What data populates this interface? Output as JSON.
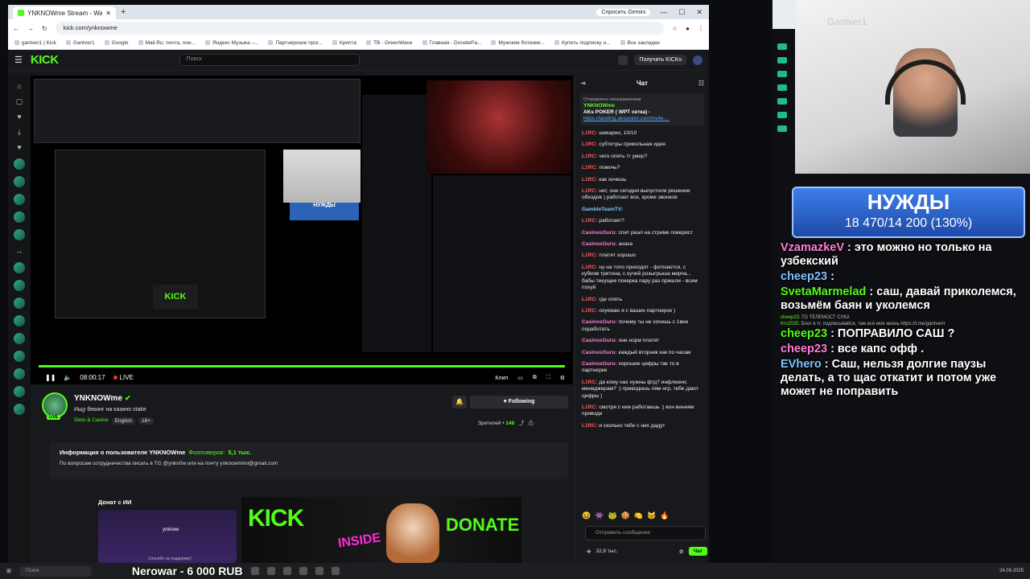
{
  "browser": {
    "tab_title": "YNKNOWme Stream - Watch L",
    "gemini_label": "Спросить Gemini",
    "url": "kick.com/ynknowme",
    "bookmarks": [
      "gantver1 | Kick",
      "Gantver1",
      "Google",
      "Mail.Ru: почта, пои...",
      "Яндекс Музыка –...",
      "Партнерские прог...",
      "Крипта",
      "TB - GreenWave",
      "Главная - DonatePa...",
      "Мужские ботинки...",
      "Купить подписку н...",
      "Все закладки"
    ]
  },
  "kick": {
    "logo": "KICK",
    "search_placeholder": "Поиск",
    "kicks_button": "Получить KICKs"
  },
  "player": {
    "time": "08:00:17",
    "live_label": "LIVE",
    "clip_label": "Клип",
    "nuzhdy_mini": "НУЖДЫ",
    "kick_inside_mini": "KICK"
  },
  "channel": {
    "name": "YNKNOWme",
    "title": "Ищу бекинг на казино stake",
    "category": "Slots & Casino",
    "tags": [
      "English",
      "18+"
    ],
    "follow_label": "Following",
    "viewers_label": "Зрителей •",
    "viewers_count": "146",
    "about_title": "Информация о пользователе YNKNOWme",
    "followers_label": "Фолловеров:",
    "followers_count": "5,1 тыс.",
    "about_text": "По вопросам сотрудничества писать в TG @ynkn0w или на почту ynknowmimi@gmail.com",
    "donate_label": "Донат с ИИ",
    "donate_card_name": "ynknow",
    "donate_card_foot": "Спасибо за поддержку!",
    "banner_kick": "KICK",
    "banner_inside": "INSIDE",
    "banner_donate": "DONATE"
  },
  "chat": {
    "header": "Чат",
    "pinned_label": "Отправлено пользователем",
    "pinned_user": "YNKNOWme",
    "pinned_title": "AKs POKER ( WPT сетка) -",
    "pinned_link": "https://landing.akspoker.com/invite-...",
    "messages": [
      {
        "user": "L1RC:",
        "text": "шикарно, 10/10",
        "color": "red"
      },
      {
        "user": "L1RC:",
        "text": "субтитры прикольная идея",
        "color": "red"
      },
      {
        "user": "L1RC:",
        "text": "чего опять тг умер?",
        "color": "red"
      },
      {
        "user": "L1RC:",
        "text": "помочь?",
        "color": "red"
      },
      {
        "user": "L1RC:",
        "text": "как хочешь",
        "color": "red"
      },
      {
        "user": "L1RC:",
        "text": "нет, они сегодня выпустили решение обходов ) работает все, кроме звонков",
        "color": "red"
      },
      {
        "user": "GambleTeamTV:",
        "text": "",
        "color": "blue"
      },
      {
        "user": "L1RC:",
        "text": "работает?",
        "color": "red"
      },
      {
        "user": "CasinosGuru:",
        "text": "спит реал на стриме покерист",
        "color": "pink"
      },
      {
        "user": "CasinosGuru:",
        "text": "ахаха",
        "color": "pink"
      },
      {
        "user": "L1RC:",
        "text": "платят хорошо",
        "color": "red"
      },
      {
        "user": "L1RC:",
        "text": "ну на топо приходят - фоткаются, с кубком тритона, с кучей розыгрыша мерча... бабы текущие покерка пару раз пришли - всем похуй",
        "color": "red"
      },
      {
        "user": "L1RC:",
        "text": "где опять",
        "color": "red"
      },
      {
        "user": "L1RC:",
        "text": "охуеваю я с ваших партнерок )",
        "color": "red"
      },
      {
        "user": "CasinosGuru:",
        "text": "почему ты не хочешь с 1вин поработать",
        "color": "pink"
      },
      {
        "user": "CasinosGuru:",
        "text": "они норм платят",
        "color": "pink"
      },
      {
        "user": "CasinosGuru:",
        "text": "каждый вторник как по часам",
        "color": "pink"
      },
      {
        "user": "CasinosGuru:",
        "text": "хорошие цифры так то в партнерке",
        "color": "pink"
      },
      {
        "user": "L1RC:",
        "text": "да кому нах нужны фтд? инфлюенс менеджерам? :) приводишь лям нгр, тебе дают цифры )",
        "color": "red"
      },
      {
        "user": "L1RC:",
        "text": "смотря с кем работаешь :) вон винням приводи",
        "color": "red"
      },
      {
        "user": "L1RC:",
        "text": "и сколько тебе с них дадут",
        "color": "red"
      }
    ],
    "input_placeholder": "Отправить сообщение",
    "viewers_short": "32,8 тыс.",
    "send_label": "Чат"
  },
  "overlay": {
    "watermark": "Gantver1",
    "goal_title": "НУЖДЫ",
    "goal_value": "18 470/14 200 (130%)",
    "lines": [
      {
        "type": "big",
        "user": "VzamazkeV",
        "text": ": это можно но только на узбекский"
      },
      {
        "type": "big",
        "user": "cheep23",
        "text": ":"
      },
      {
        "type": "big",
        "user": "SvetaMarmelad",
        "text": ": саш, давай приколемся, возьмём баян и уколемся"
      },
      {
        "type": "small",
        "user": "cheep23:",
        "text": "ГО ТЕЛЕМОСТ СУКА"
      },
      {
        "type": "small",
        "user": "Krs2025:",
        "text": "Блог в тг, подписывайся, там вся моя жизнь https://t.me/gantverrr"
      },
      {
        "type": "big",
        "user": "cheep23",
        "text": ": ПОПРАВИЛО САШ ?"
      },
      {
        "type": "big",
        "user": "cheep23",
        "text": ": все капс офф ."
      },
      {
        "type": "big",
        "user": "EVhero",
        "text": ": Саш, нельзя долгие паузы делать, а то щас откатит и потом уже может не поправить"
      }
    ]
  },
  "taskbar": {
    "search": "Поиск",
    "banner": "Nerowar - 6 000 RUB",
    "clock": "24.09.2025"
  }
}
